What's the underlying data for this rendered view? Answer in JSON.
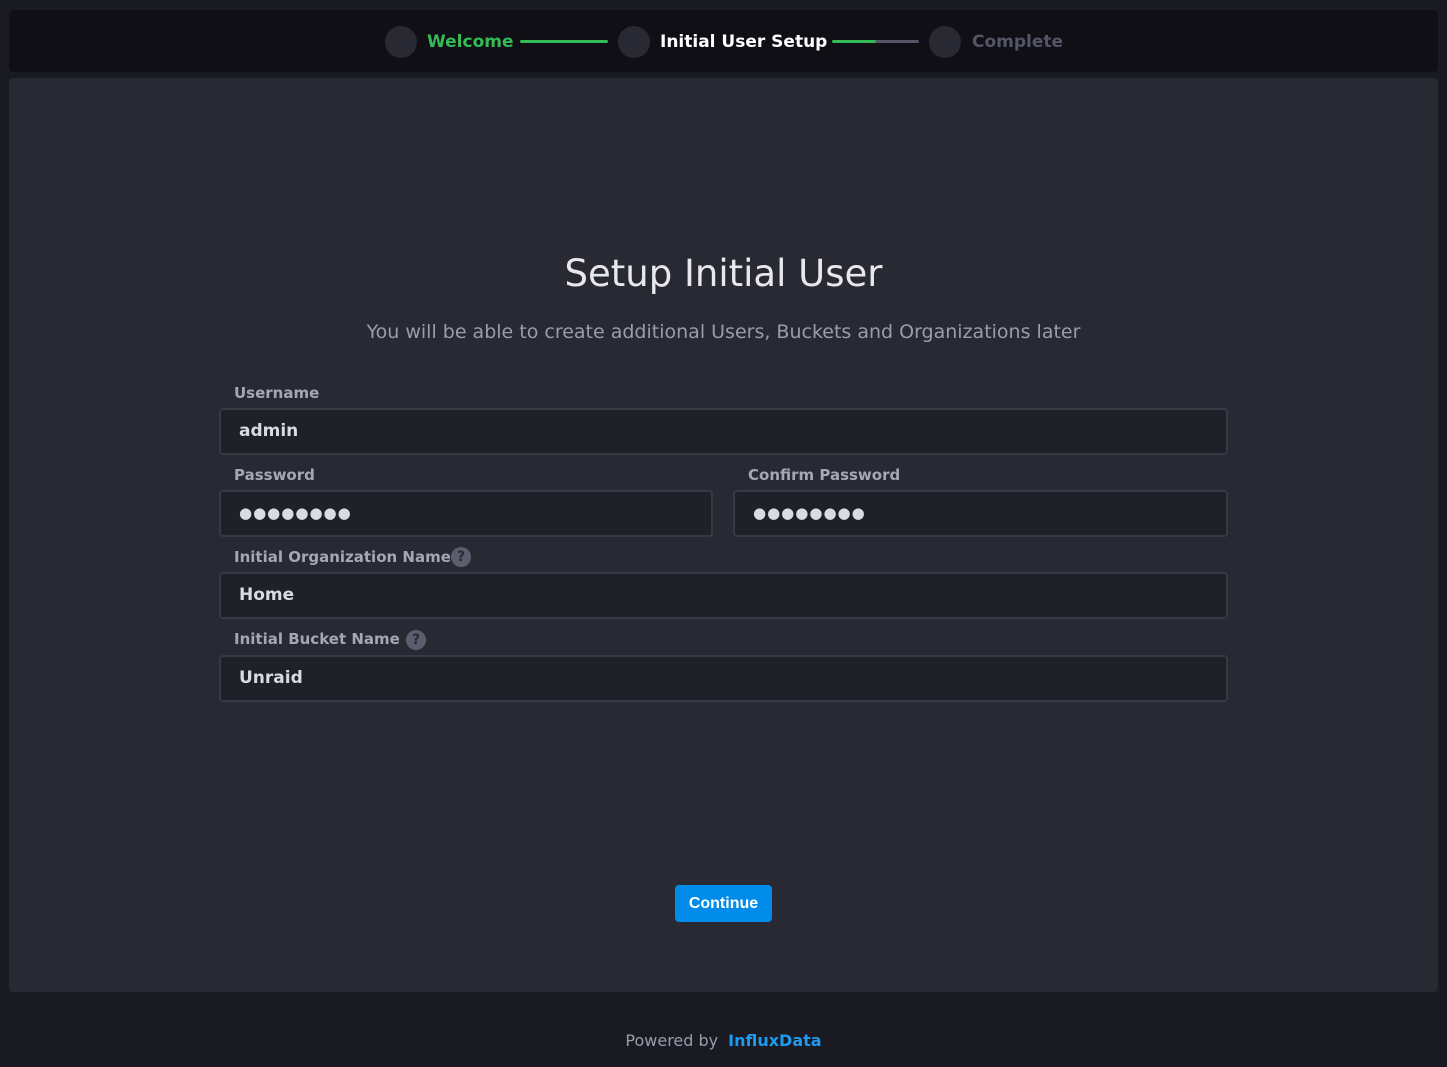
{
  "stepper": {
    "steps": [
      {
        "label": "Welcome",
        "state": "done"
      },
      {
        "label": "Initial User Setup",
        "state": "current"
      },
      {
        "label": "Complete",
        "state": "pending"
      }
    ],
    "colors": {
      "done": "#34bb55",
      "current": "#ffffff",
      "pending": "#545667"
    }
  },
  "page": {
    "title": "Setup Initial User",
    "subtitle": "You will be able to create additional Users, Buckets and Organizations later"
  },
  "form": {
    "username": {
      "label": "Username",
      "value": "admin"
    },
    "password": {
      "label": "Password",
      "value": "●●●●●●●●"
    },
    "confirm_password": {
      "label": "Confirm Password",
      "value": "●●●●●●●●"
    },
    "org": {
      "label": "Initial Organization Name",
      "value": "Home",
      "help": "?"
    },
    "bucket": {
      "label": "Initial Bucket Name",
      "value": "Unraid",
      "help": "?"
    }
  },
  "actions": {
    "continue_label": "Continue"
  },
  "footer": {
    "prefix": "Powered by",
    "brand": "InfluxData"
  }
}
